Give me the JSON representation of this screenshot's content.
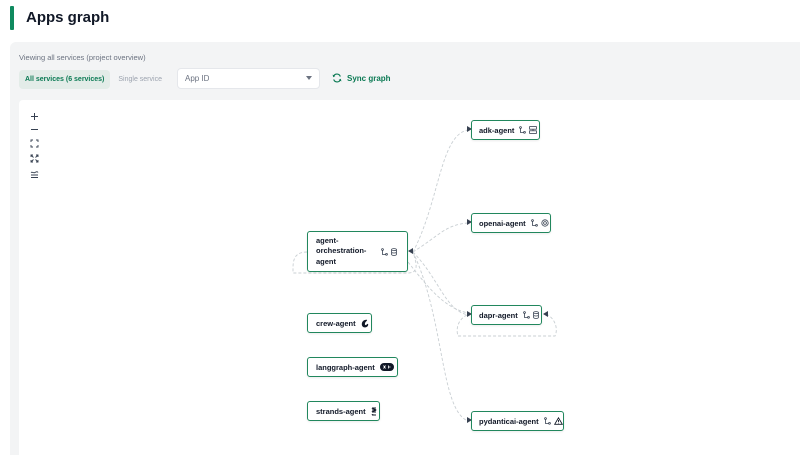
{
  "header": {
    "title": "Apps graph"
  },
  "toolbar": {
    "subtitle": "Viewing all services (project overview)",
    "toggle_all": "All services (6 services)",
    "toggle_single": "Single service",
    "app_id_placeholder": "App ID",
    "sync_label": "Sync graph"
  },
  "controls": [
    "zoom-in-icon",
    "zoom-out-icon",
    "fit-view-icon",
    "fullscreen-icon",
    "auto-layout-icon"
  ],
  "nodes": {
    "orchestrator": {
      "label_lines": [
        "agent-",
        "orchestration-",
        "agent"
      ],
      "icons": [
        "git-branch-icon",
        "database-icon"
      ]
    },
    "adk": {
      "label": "adk-agent",
      "icons": [
        "git-branch-icon",
        "workflow-icon"
      ]
    },
    "openai": {
      "label": "openai-agent",
      "icons": [
        "git-branch-icon",
        "openai-icon"
      ]
    },
    "dapr": {
      "label": "dapr-agent",
      "icons": [
        "git-branch-icon",
        "database-icon"
      ]
    },
    "crew": {
      "label": "crew-agent",
      "icons": [
        "crew-icon"
      ]
    },
    "langgraph": {
      "label": "langgraph-agent",
      "icons": [
        "langgraph-icon"
      ]
    },
    "strands": {
      "label": "strands-agent",
      "icons": [
        "strands-icon"
      ]
    },
    "pydanticai": {
      "label": "pydanticai-agent",
      "icons": [
        "git-branch-icon",
        "warning-triangle-icon"
      ]
    }
  },
  "colors": {
    "accent": "#0f8a5f",
    "node_border": "#21875d",
    "edge": "#c9cfd3"
  }
}
